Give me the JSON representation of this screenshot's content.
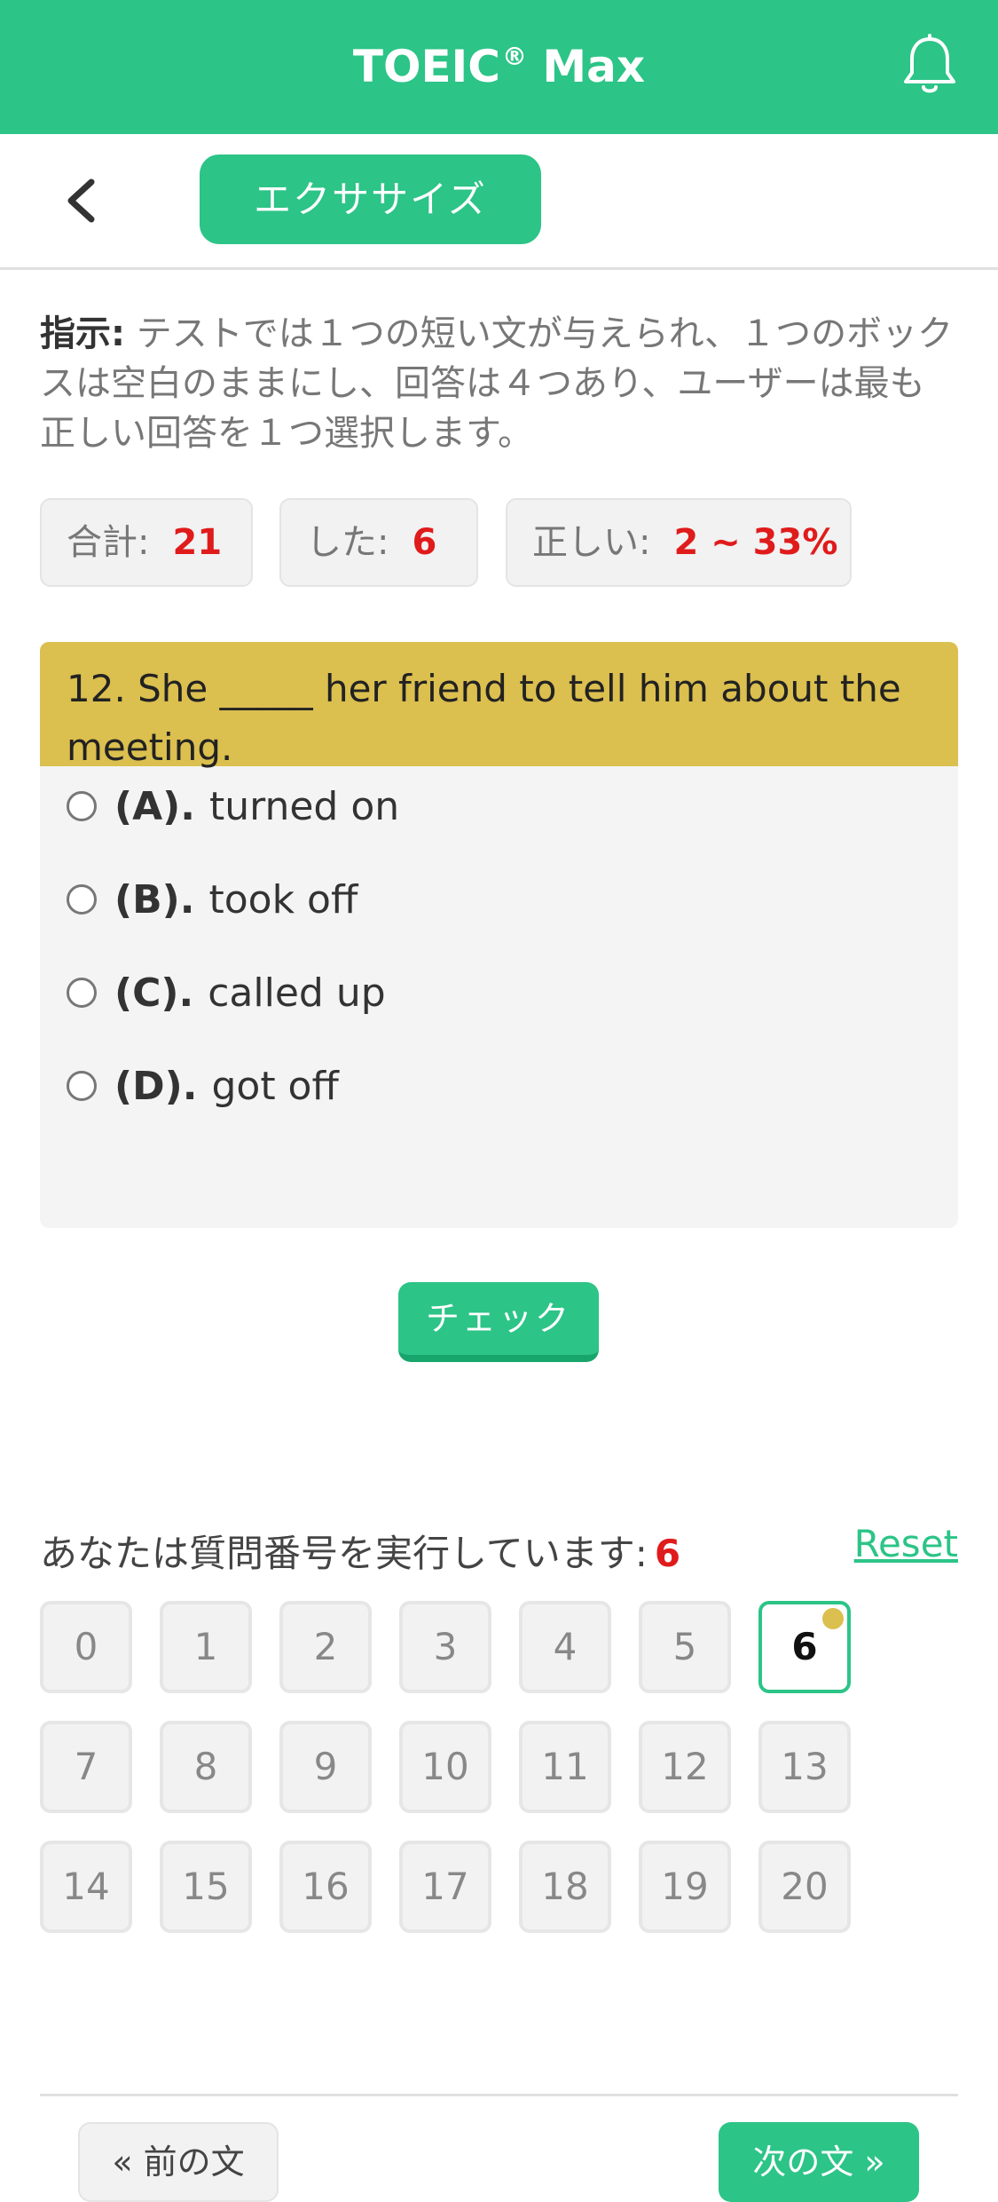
{
  "header": {
    "app_name": "TOEIC",
    "trademark": "®",
    "app_suffix": "Max",
    "icons": {
      "bell": "bell-icon",
      "back": "chevron-left-icon"
    },
    "colors": {
      "brand": "#2cc487",
      "question_header": "#dbbf4f",
      "highlight": "#e01b1b"
    }
  },
  "subbar": {
    "tab_label": "エクササイズ"
  },
  "instruction": {
    "label": "指示:",
    "text": " テストでは１つの短い文が与えられ、１つのボックスは空白のままにし、回答は４つあり、ユーザーは最も正しい回答を１つ選択します。"
  },
  "stats": {
    "total_label": "合計:",
    "total_value": "21",
    "done_label": "した:",
    "done_value": "6",
    "correct_label": "正しい:",
    "correct_value": "2 ~ 33%"
  },
  "question": {
    "text": "12. She _____ her friend to tell him about the meeting.",
    "options": [
      {
        "letter": "(A).",
        "text": "turned on"
      },
      {
        "letter": "(B).",
        "text": "took off"
      },
      {
        "letter": "(C).",
        "text": "called up"
      },
      {
        "letter": "(D).",
        "text": "got off"
      }
    ]
  },
  "check_button": "チェック",
  "progress": {
    "label": "あなたは質問番号を実行しています:",
    "current": "6",
    "reset": "Reset"
  },
  "numbers": [
    "0",
    "1",
    "2",
    "3",
    "4",
    "5",
    "6",
    "7",
    "8",
    "9",
    "10",
    "11",
    "12",
    "13",
    "14",
    "15",
    "16",
    "17",
    "18",
    "19",
    "20"
  ],
  "active_number": 6,
  "nav": {
    "prev": "« 前の文",
    "next": "次の文 »"
  }
}
